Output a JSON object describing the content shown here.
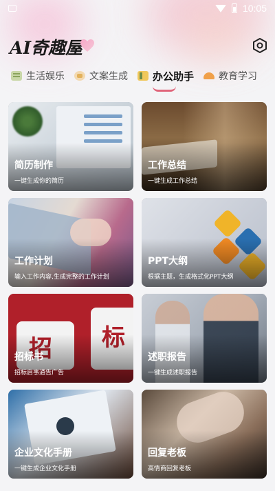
{
  "status_bar": {
    "time": "10:05"
  },
  "header": {
    "app_title": "AI奇趣屋"
  },
  "tabs": [
    {
      "label": "生活娱乐",
      "icon": "book-icon",
      "active": false
    },
    {
      "label": "文案生成",
      "icon": "sparkle-icon",
      "active": false
    },
    {
      "label": "办公助手",
      "icon": "briefcase-icon",
      "active": true
    },
    {
      "label": "教育学习",
      "icon": "graduation-cap-icon",
      "active": false
    }
  ],
  "cards": [
    {
      "title": "简历制作",
      "subtitle": "一键生成你的简历"
    },
    {
      "title": "工作总结",
      "subtitle": "一键生成工作总结"
    },
    {
      "title": "工作计划",
      "subtitle": "输入工作内容,生成完整的工作计划"
    },
    {
      "title": "PPT大纲",
      "subtitle": "根据主题，生成格式化PPT大纲"
    },
    {
      "title": "招标书",
      "subtitle": "招标启事通告广告"
    },
    {
      "title": "述职报告",
      "subtitle": "一键生成述职报告"
    },
    {
      "title": "企业文化手册",
      "subtitle": "一键生成企业文化手册"
    },
    {
      "title": "回复老板",
      "subtitle": "高情商回复老板"
    }
  ],
  "card_art": {
    "bid_chars": [
      "招",
      "标"
    ]
  },
  "colors": {
    "accent_underline": "#e0657a",
    "bid_red": "#b0202a"
  }
}
